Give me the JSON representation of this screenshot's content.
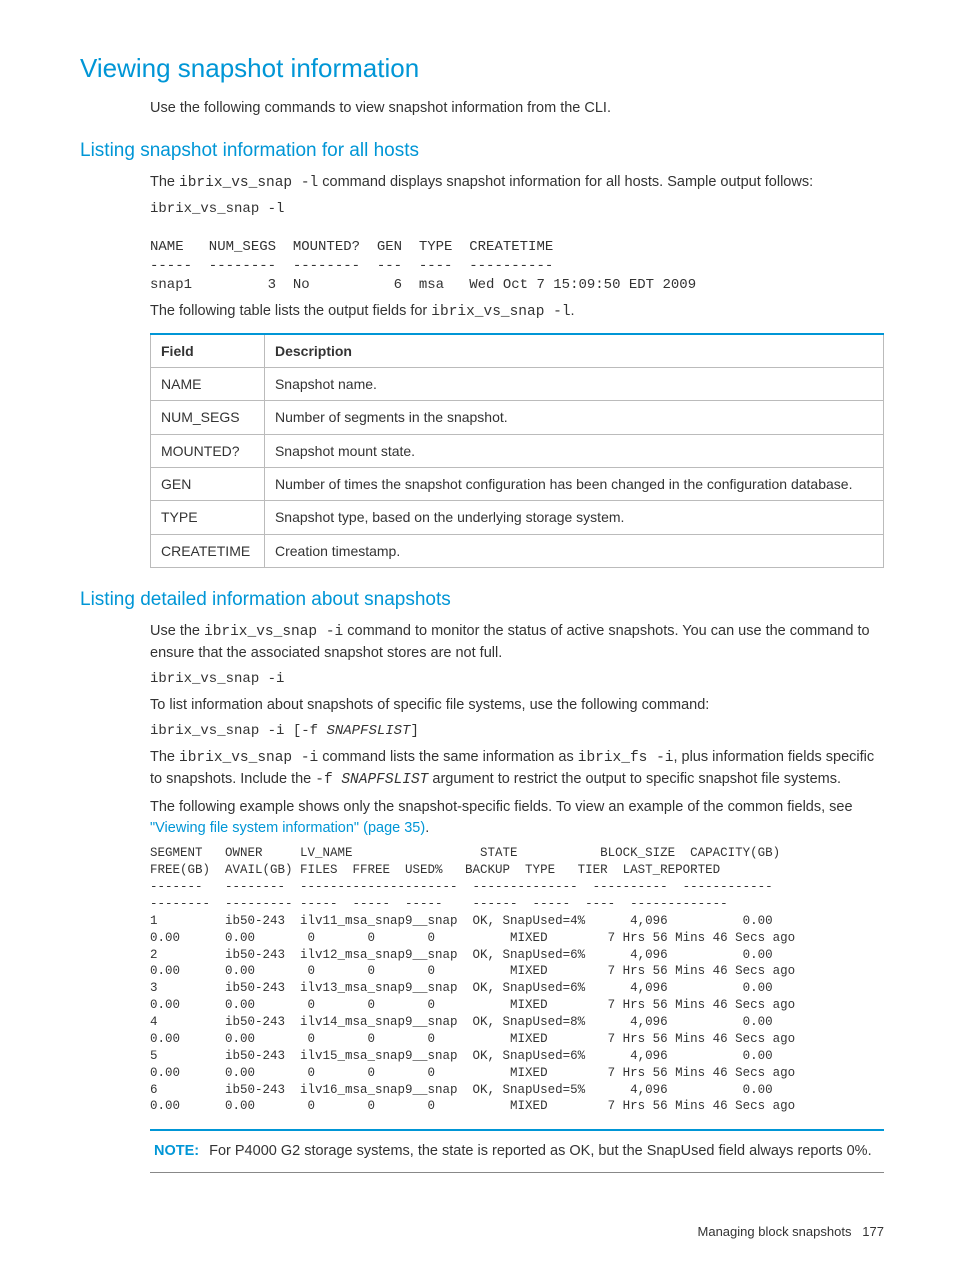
{
  "h1": "Viewing snapshot information",
  "intro": "Use the following commands to view snapshot information from the CLI.",
  "sec1": {
    "heading": "Listing snapshot information for all hosts",
    "p1a": "The ",
    "p1cmd": "ibrix_vs_snap -l",
    "p1b": " command displays snapshot information for all hosts. Sample output follows:",
    "code1": "ibrix_vs_snap -l\n\nNAME   NUM_SEGS  MOUNTED?  GEN  TYPE  CREATETIME\n-----  --------  --------  ---  ----  ----------\nsnap1         3  No          6  msa   Wed Oct 7 15:09:50 EDT 2009",
    "p2a": "The following table lists the output fields for ",
    "p2cmd": "ibrix_vs_snap -l",
    "p2b": ".",
    "table": {
      "h1": "Field",
      "h2": "Description",
      "rows": [
        {
          "f": "NAME",
          "d": "Snapshot name."
        },
        {
          "f": "NUM_SEGS",
          "d": "Number of segments in the snapshot."
        },
        {
          "f": "MOUNTED?",
          "d": "Snapshot mount state."
        },
        {
          "f": "GEN",
          "d": "Number of times the snapshot configuration has been changed in the configuration database."
        },
        {
          "f": "TYPE",
          "d": "Snapshot type, based on the underlying storage system."
        },
        {
          "f": "CREATETIME",
          "d": "Creation timestamp."
        }
      ]
    }
  },
  "sec2": {
    "heading": "Listing detailed information about snapshots",
    "p1a": "Use the ",
    "p1cmd": "ibrix_vs_snap -i",
    "p1b": " command to monitor the status of active snapshots. You can use the command to ensure that the associated snapshot stores are not full.",
    "code1": "ibrix_vs_snap -i",
    "p2": "To list information about snapshots of specific file systems, use the following command:",
    "code2a": "ibrix_vs_snap -i [-f ",
    "code2b": "SNAPFSLIST",
    "code2c": "]",
    "p3a": "The ",
    "p3cmd1": "ibrix_vs_snap -i",
    "p3b": " command lists the same information as ",
    "p3cmd2": "ibrix_fs -i",
    "p3c": ", plus information fields specific to snapshots. Include the ",
    "p3cmd3": "-f ",
    "p3arg": "SNAPFSLIST",
    "p3d": " argument to restrict the output to specific snapshot file systems.",
    "p4a": "The following example shows only the snapshot-specific fields. To view an example of the common fields, see ",
    "p4link": "\"Viewing file system information\" (page 35)",
    "p4b": ".",
    "code3": "SEGMENT   OWNER     LV_NAME                 STATE           BLOCK_SIZE  CAPACITY(GB)\nFREE(GB)  AVAIL(GB) FILES  FFREE  USED%   BACKUP  TYPE   TIER  LAST_REPORTED\n-------   --------  ---------------------  --------------  ----------  ------------\n--------  --------- -----  -----  -----    ------  -----  ----  -------------\n1         ib50-243  ilv11_msa_snap9__snap  OK, SnapUsed=4%      4,096          0.00\n0.00      0.00       0       0       0          MIXED        7 Hrs 56 Mins 46 Secs ago\n2         ib50-243  ilv12_msa_snap9__snap  OK, SnapUsed=6%      4,096          0.00\n0.00      0.00       0       0       0          MIXED        7 Hrs 56 Mins 46 Secs ago\n3         ib50-243  ilv13_msa_snap9__snap  OK, SnapUsed=6%      4,096          0.00\n0.00      0.00       0       0       0          MIXED        7 Hrs 56 Mins 46 Secs ago\n4         ib50-243  ilv14_msa_snap9__snap  OK, SnapUsed=8%      4,096          0.00\n0.00      0.00       0       0       0          MIXED        7 Hrs 56 Mins 46 Secs ago\n5         ib50-243  ilv15_msa_snap9__snap  OK, SnapUsed=6%      4,096          0.00\n0.00      0.00       0       0       0          MIXED        7 Hrs 56 Mins 46 Secs ago\n6         ib50-243  ilv16_msa_snap9__snap  OK, SnapUsed=5%      4,096          0.00\n0.00      0.00       0       0       0          MIXED        7 Hrs 56 Mins 46 Secs ago",
    "note_label": "NOTE:",
    "note_text": "For P4000 G2 storage systems, the state is reported as OK, but the SnapUsed field always reports 0%."
  },
  "footer": {
    "text": "Managing block snapshots",
    "page": "177"
  }
}
